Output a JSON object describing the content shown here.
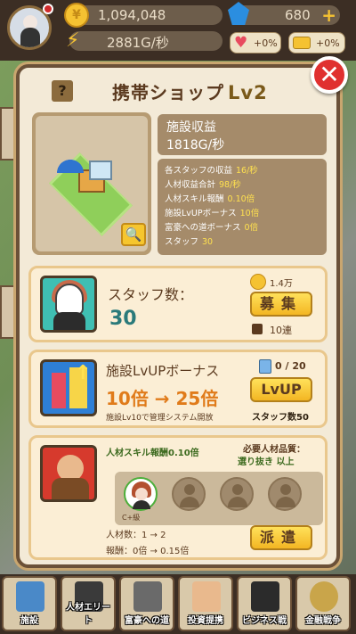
{
  "header": {
    "money": "1,094,048",
    "money_rate": "2881G/秒",
    "gems": "680",
    "heart_bonus": "+0%",
    "gold_bonus": "+0%"
  },
  "modal": {
    "help_label": "?",
    "close_label": "✕",
    "title": "携帯ショップ",
    "level": "Lv2",
    "income_label": "施設収益",
    "income_value": "1818G/秒",
    "stats": [
      {
        "label": "各スタッフの収益",
        "value": "16/秒"
      },
      {
        "label": "人材収益合計",
        "value": "98/秒"
      },
      {
        "label": "人材スキル報酬",
        "value": "0.10倍"
      },
      {
        "label": "施設LvUPボーナス",
        "value": "10倍"
      },
      {
        "label": "富豪への道ボーナス",
        "value": "0倍"
      },
      {
        "label": "スタッフ",
        "value": "30"
      }
    ]
  },
  "staff": {
    "label": "スタッフ数：",
    "value": "30",
    "cost": "1.4万",
    "recruit_button": "募集",
    "recruit10_label": "10連"
  },
  "lvup": {
    "label": "施設LvUPボーナス",
    "multiplier": "10倍 → 25倍",
    "unlock_note": "施設Lv10で管理システム開放",
    "progress": "0 / 20",
    "button": "LvUP",
    "staff_req": "スタッフ数50"
  },
  "dispatch": {
    "skill_reward": "人材スキル報酬0.10倍",
    "req_label": "必要人材品質：",
    "req_value": "選り抜き 以上",
    "filled_slot_tag": "C+級",
    "people": "人材数：1 → 2",
    "reward": "報酬：0倍 → 0.15倍",
    "button": "派遣"
  },
  "nav": [
    {
      "label": "施設"
    },
    {
      "label": "人材エリート"
    },
    {
      "label": "富豪への道"
    },
    {
      "label": "投資提携"
    },
    {
      "label": "ビジネス戦"
    },
    {
      "label": "金融戦争"
    }
  ],
  "colors": {
    "accent": "#f5c232",
    "close": "#e0302f",
    "panel": "#f3ead7",
    "highlight_value": "#ffe14f"
  }
}
